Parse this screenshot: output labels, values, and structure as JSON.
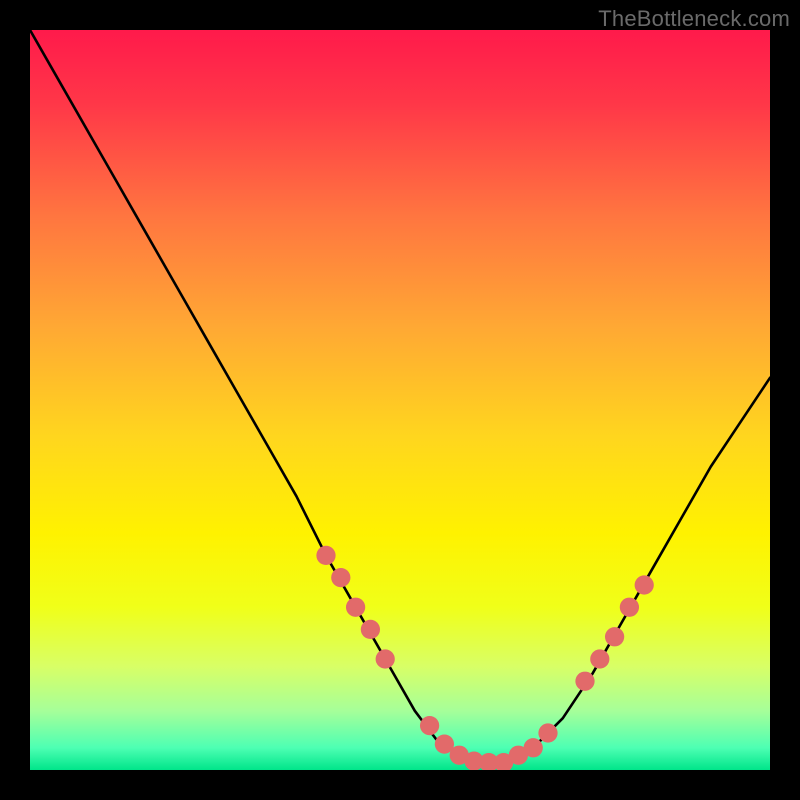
{
  "watermark": "TheBottleneck.com",
  "chart_data": {
    "type": "line",
    "title": "",
    "xlabel": "",
    "ylabel": "",
    "xlim": [
      0,
      100
    ],
    "ylim": [
      0,
      100
    ],
    "grid": false,
    "legend": false,
    "background_gradient": {
      "stops": [
        {
          "offset": 0.0,
          "color": "#ff1a4b"
        },
        {
          "offset": 0.1,
          "color": "#ff3748"
        },
        {
          "offset": 0.25,
          "color": "#ff7540"
        },
        {
          "offset": 0.4,
          "color": "#ffa834"
        },
        {
          "offset": 0.55,
          "color": "#ffd61e"
        },
        {
          "offset": 0.68,
          "color": "#fff200"
        },
        {
          "offset": 0.78,
          "color": "#f0ff19"
        },
        {
          "offset": 0.86,
          "color": "#d8ff66"
        },
        {
          "offset": 0.92,
          "color": "#a6ff99"
        },
        {
          "offset": 0.97,
          "color": "#4dffb3"
        },
        {
          "offset": 1.0,
          "color": "#00e58a"
        }
      ]
    },
    "series": [
      {
        "name": "bottleneck-curve",
        "x": [
          0,
          4,
          8,
          12,
          16,
          20,
          24,
          28,
          32,
          36,
          40,
          44,
          48,
          52,
          55,
          58,
          61,
          64,
          68,
          72,
          76,
          80,
          84,
          88,
          92,
          96,
          100
        ],
        "values": [
          100,
          93,
          86,
          79,
          72,
          65,
          58,
          51,
          44,
          37,
          29,
          22,
          15,
          8,
          4,
          2,
          1,
          1,
          3,
          7,
          13,
          20,
          27,
          34,
          41,
          47,
          53
        ]
      }
    ],
    "markers": {
      "name": "highlighted-points",
      "color": "#e26a6a",
      "radius_pct": 1.3,
      "points": [
        {
          "x": 40,
          "y": 29
        },
        {
          "x": 42,
          "y": 26
        },
        {
          "x": 44,
          "y": 22
        },
        {
          "x": 46,
          "y": 19
        },
        {
          "x": 48,
          "y": 15
        },
        {
          "x": 54,
          "y": 6
        },
        {
          "x": 56,
          "y": 3.5
        },
        {
          "x": 58,
          "y": 2
        },
        {
          "x": 60,
          "y": 1.2
        },
        {
          "x": 62,
          "y": 1
        },
        {
          "x": 64,
          "y": 1
        },
        {
          "x": 66,
          "y": 2
        },
        {
          "x": 68,
          "y": 3
        },
        {
          "x": 70,
          "y": 5
        },
        {
          "x": 75,
          "y": 12
        },
        {
          "x": 77,
          "y": 15
        },
        {
          "x": 79,
          "y": 18
        },
        {
          "x": 81,
          "y": 22
        },
        {
          "x": 83,
          "y": 25
        }
      ]
    }
  }
}
